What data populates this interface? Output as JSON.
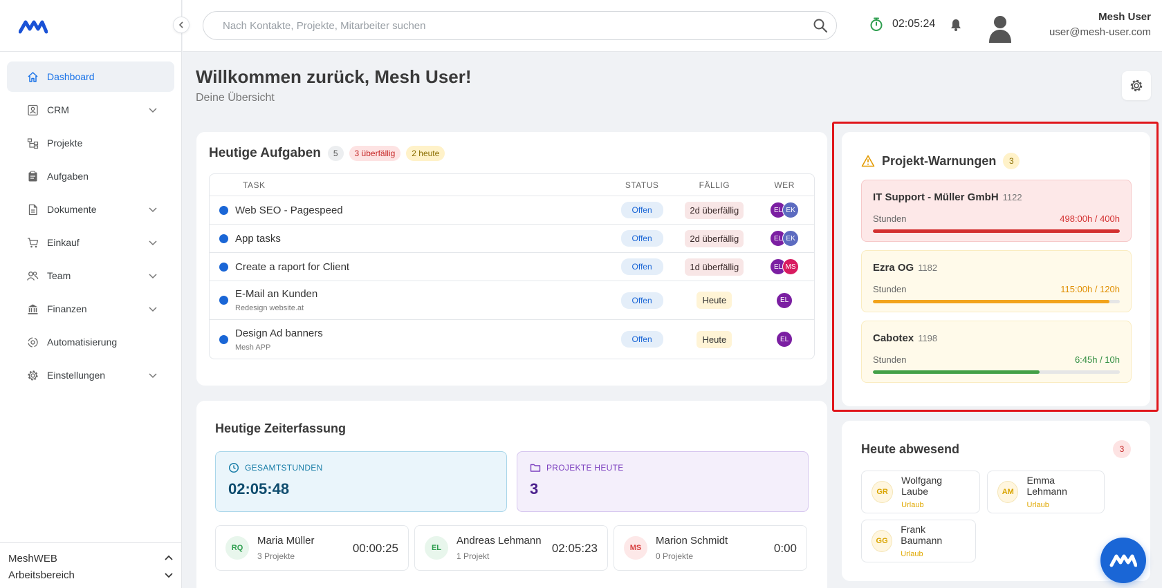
{
  "sidebar": {
    "items": [
      {
        "label": "Dashboard",
        "icon": "home-icon"
      },
      {
        "label": "CRM",
        "icon": "contact-card-icon"
      },
      {
        "label": "Projekte",
        "icon": "project-tree-icon"
      },
      {
        "label": "Aufgaben",
        "icon": "clipboard-icon"
      },
      {
        "label": "Dokumente",
        "icon": "document-icon"
      },
      {
        "label": "Einkauf",
        "icon": "cart-icon"
      },
      {
        "label": "Team",
        "icon": "team-icon"
      },
      {
        "label": "Finanzen",
        "icon": "bank-icon"
      },
      {
        "label": "Automatisierung",
        "icon": "automation-icon"
      },
      {
        "label": "Einstellungen",
        "icon": "gear-icon"
      }
    ],
    "workspace": {
      "name": "MeshWEB",
      "label": "Arbeitsbereich"
    }
  },
  "topbar": {
    "search_placeholder": "Nach Kontakte, Projekte, Mitarbeiter suchen",
    "timer": "02:05:24",
    "user_name": "Mesh User",
    "user_email": "user@mesh-user.com"
  },
  "header": {
    "title": "Willkommen zurück, Mesh User!",
    "subtitle": "Deine Übersicht"
  },
  "tasks": {
    "title": "Heutige Aufgaben",
    "count": "5",
    "overdue_badge": "3 überfällig",
    "today_badge": "2 heute",
    "columns": {
      "task": "TASK",
      "status": "STATUS",
      "due": "FÄLLIG",
      "who": "WER"
    },
    "rows": [
      {
        "name": "Web SEO - Pagespeed",
        "sub": "",
        "status": "Offen",
        "due": "2d überfällig",
        "due_type": "overdue",
        "assignees": [
          {
            "initials": "EL",
            "color": "#7b1fa2"
          },
          {
            "initials": "EK",
            "color": "#5c6bc0"
          }
        ]
      },
      {
        "name": "App tasks",
        "sub": "",
        "status": "Offen",
        "due": "2d überfällig",
        "due_type": "overdue",
        "assignees": [
          {
            "initials": "EL",
            "color": "#7b1fa2"
          },
          {
            "initials": "EK",
            "color": "#5c6bc0"
          }
        ]
      },
      {
        "name": "Create a raport for Client",
        "sub": "",
        "status": "Offen",
        "due": "1d überfällig",
        "due_type": "overdue",
        "assignees": [
          {
            "initials": "EL",
            "color": "#7b1fa2"
          },
          {
            "initials": "MS",
            "color": "#d81b60"
          }
        ]
      },
      {
        "name": "E-Mail an Kunden",
        "sub": "Redesign website.at",
        "status": "Offen",
        "due": "Heute",
        "due_type": "today",
        "assignees": [
          {
            "initials": "EL",
            "color": "#7b1fa2"
          }
        ]
      },
      {
        "name": "Design Ad banners",
        "sub": "Mesh APP",
        "status": "Offen",
        "due": "Heute",
        "due_type": "today",
        "assignees": [
          {
            "initials": "EL",
            "color": "#7b1fa2"
          }
        ]
      }
    ]
  },
  "time_tracking": {
    "title": "Heutige Zeiterfassung",
    "total_label": "GESAMTSTUNDEN",
    "total_value": "02:05:48",
    "projects_label": "PROJEKTE HEUTE",
    "projects_value": "3",
    "employees": [
      {
        "initials": "RQ",
        "name": "Maria Müller",
        "projects": "3 Projekte",
        "time": "00:00:25",
        "color": "#2e9e4f",
        "bg": "#e8f6ec"
      },
      {
        "initials": "EL",
        "name": "Andreas Lehmann",
        "projects": "1 Projekt",
        "time": "02:05:23",
        "color": "#2e9e4f",
        "bg": "#e8f6ec"
      },
      {
        "initials": "MS",
        "name": "Marion Schmidt",
        "projects": "0 Projekte",
        "time": "0:00",
        "color": "#d84343",
        "bg": "#fde8e8"
      }
    ]
  },
  "warnings": {
    "title": "Projekt-Warnungen",
    "count": "3",
    "items": [
      {
        "name": "IT Support - Müller GmbH",
        "id": "1122",
        "label": "Stunden",
        "hours": "498:00h / 400h",
        "fraction": 1.0,
        "bar": "#d32f2f",
        "bg": "#fde8e8",
        "border": "#f6c9c9",
        "text": "#d32f2f"
      },
      {
        "name": "Ezra OG",
        "id": "1182",
        "label": "Stunden",
        "hours": "115:00h / 120h",
        "fraction": 0.958,
        "bar": "#f2a31b",
        "bg": "#fffaea",
        "border": "#faecc0",
        "text": "#e08e00"
      },
      {
        "name": "Cabotex",
        "id": "1198",
        "label": "Stunden",
        "hours": "6:45h / 10h",
        "fraction": 0.675,
        "bar": "#43a047",
        "bg": "#fffaea",
        "border": "#faecc0",
        "text": "#2e8b3d"
      }
    ]
  },
  "absent": {
    "title": "Heute abwesend",
    "count": "3",
    "people": [
      {
        "initials": "GR",
        "name": "Wolfgang Laube",
        "status": "Urlaub"
      },
      {
        "initials": "AM",
        "name": "Emma Lehmann",
        "status": "Urlaub"
      },
      {
        "initials": "GG",
        "name": "Frank Baumann",
        "status": "Urlaub"
      }
    ]
  },
  "colors": {
    "accent": "#1a66d6",
    "danger": "#d32f2f",
    "warning": "#f2a31b",
    "success": "#43a047"
  }
}
